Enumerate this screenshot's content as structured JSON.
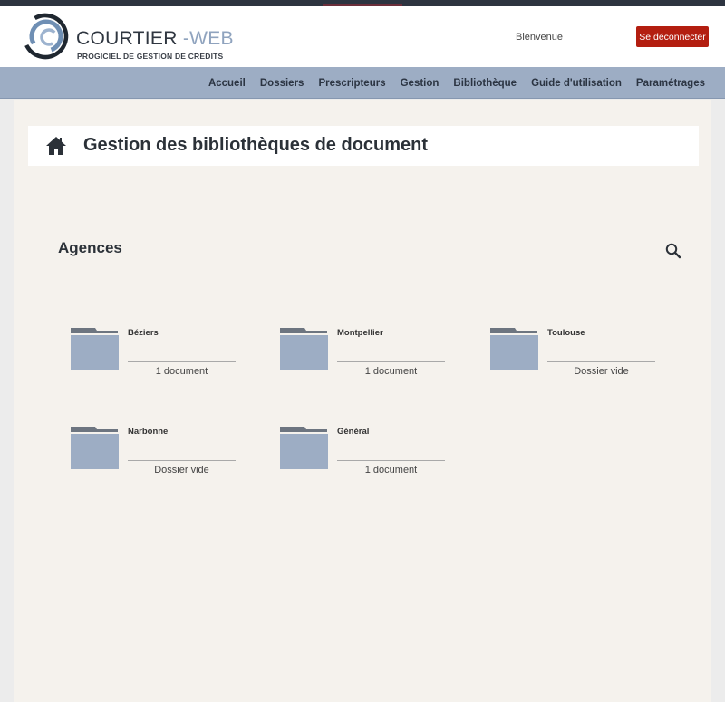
{
  "header": {
    "logo_main": "COURTIER",
    "logo_accent": " -WEB",
    "logo_subtitle": "PROGICIEL DE GESTION DE CREDITS",
    "welcome_text": "Bienvenue",
    "logout_label": "Se déconnecter"
  },
  "nav": {
    "items": [
      "Accueil",
      "Dossiers",
      "Prescripteurs",
      "Gestion",
      "Bibliothèque",
      "Guide d'utilisation",
      "Paramétrages"
    ]
  },
  "page": {
    "title": "Gestion des bibliothèques de document",
    "section_title": "Agences"
  },
  "folders": [
    {
      "name": "Béziers",
      "count": "1 document"
    },
    {
      "name": "Montpellier",
      "count": "1 document"
    },
    {
      "name": "Toulouse",
      "count": "Dossier vide"
    },
    {
      "name": "Narbonne",
      "count": "Dossier vide"
    },
    {
      "name": "Général",
      "count": "1 document"
    }
  ],
  "colors": {
    "accent": "#b31e10",
    "navbar": "#9dadc4",
    "folder": "#9dadc4",
    "folder_tab": "#6d7580"
  },
  "icons": [
    "home-icon",
    "search-icon",
    "folder-icon"
  ]
}
